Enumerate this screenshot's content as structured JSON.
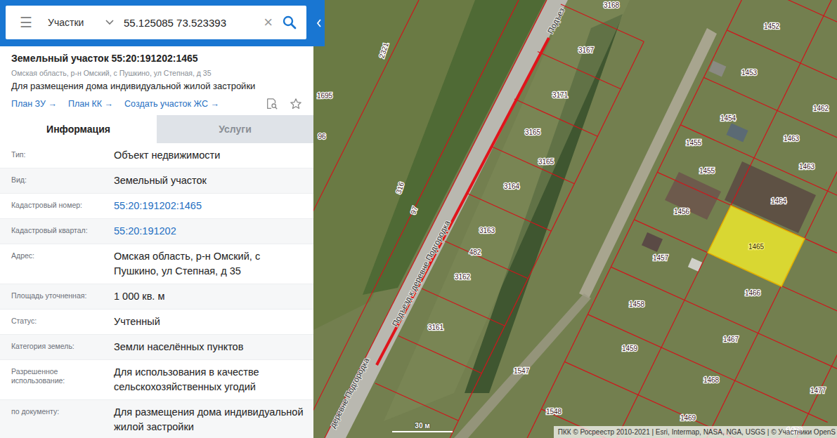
{
  "search": {
    "menu": "☰",
    "layer": "Участки",
    "query": "55.125085 73.523393",
    "clear": "×"
  },
  "card": {
    "title": "Земельный участок 55:20:191202:1465",
    "address": "Омская область, р-н Омский, с Пушкино, ул Степная, д 35",
    "purpose": "Для размещения дома индивидуальной жилой застройки",
    "links": [
      "План ЗУ →",
      "План КК →",
      "Создать участок ЖС →"
    ]
  },
  "tabs": [
    {
      "label": "Информация",
      "selected": true
    },
    {
      "label": "Услуги",
      "selected": false
    }
  ],
  "fields": [
    {
      "label": "Тип:",
      "value": "Объект недвижимости",
      "link": false
    },
    {
      "label": "Вид:",
      "value": "Земельный участок",
      "link": false
    },
    {
      "label": "Кадастровый номер:",
      "value": "55:20:191202:1465",
      "link": true
    },
    {
      "label": "Кадастровый квартал:",
      "value": "55:20:191202",
      "link": true
    },
    {
      "label": "Адрес:",
      "value": "Омская область, р-н Омский, с Пушкино, ул Степная, д 35",
      "link": false
    },
    {
      "label": "Площадь уточненная:",
      "value": "1 000 кв. м",
      "link": false
    },
    {
      "label": "Статус:",
      "value": "Учтенный",
      "link": false
    },
    {
      "label": "Категория земель:",
      "value": "Земли населённых пунктов",
      "link": false
    },
    {
      "label": "Разрешенное использование:",
      "value": "Для использования в качестве сельскохозяйственных угодий",
      "link": false
    },
    {
      "label": "по документу:",
      "value": "Для размещения дома индивидуальной жилой застройки",
      "link": false
    }
  ],
  "map": {
    "parcels": [
      {
        "label": "3168",
        "selected": false
      },
      {
        "label": "1452",
        "selected": false
      },
      {
        "label": "1695",
        "selected": false
      },
      {
        "label": "2321",
        "selected": false
      },
      {
        "label": "3167",
        "selected": false
      },
      {
        "label": "1453",
        "selected": false
      },
      {
        "label": "1462",
        "selected": false
      },
      {
        "label": "3171",
        "selected": false
      },
      {
        "label": "1454",
        "selected": false
      },
      {
        "label": "1455",
        "selected": false
      },
      {
        "label": "1463",
        "selected": false
      },
      {
        "label": "3165",
        "selected": false
      },
      {
        "label": "1455",
        "selected": false
      },
      {
        "label": "1463",
        "selected": false
      },
      {
        "label": "3165",
        "selected": false
      },
      {
        "label": "96",
        "selected": false
      },
      {
        "label": "3164",
        "selected": false
      },
      {
        "label": "1456",
        "selected": false
      },
      {
        "label": "1464",
        "selected": false
      },
      {
        "label": "316",
        "selected": false
      },
      {
        "label": "97",
        "selected": false
      },
      {
        "label": "3163",
        "selected": false
      },
      {
        "label": "482",
        "selected": false
      },
      {
        "label": "1465",
        "selected": true
      },
      {
        "label": "1457",
        "selected": false
      },
      {
        "label": "3162",
        "selected": false
      },
      {
        "label": "1466",
        "selected": false
      },
      {
        "label": "1458",
        "selected": false
      },
      {
        "label": "3161",
        "selected": false
      },
      {
        "label": "1467",
        "selected": false
      },
      {
        "label": "1459",
        "selected": false
      },
      {
        "label": "1547",
        "selected": false
      },
      {
        "label": "1468",
        "selected": false
      },
      {
        "label": "1477",
        "selected": false
      },
      {
        "label": "1548",
        "selected": false
      },
      {
        "label": "1469",
        "selected": false
      },
      {
        "label": "1478",
        "selected": false
      }
    ],
    "roads": [
      {
        "text": "Подъезд к деревне Подгородка"
      },
      {
        "text": "Подъез"
      },
      {
        "text": "деревне Подгородка"
      }
    ],
    "scale": "30 м",
    "attribution": "ПКК © Росреестр 2010-2021 | Esri, Intermap, NASA, NGA, USGS | © Участники OpenS"
  }
}
